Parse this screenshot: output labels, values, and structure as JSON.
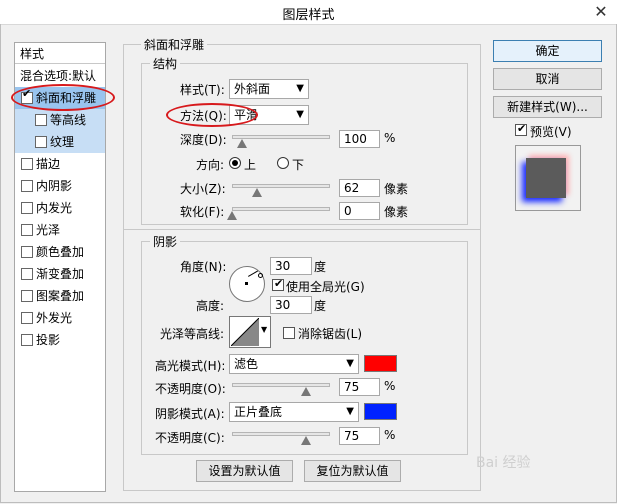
{
  "window": {
    "title": "图层样式",
    "close_icon": "close-icon"
  },
  "style_list": {
    "header": "样式",
    "items": [
      {
        "label": "混合选项:默认",
        "checkbox": false,
        "checked": false,
        "sub": false,
        "state": "none"
      },
      {
        "label": "斜面和浮雕",
        "checkbox": true,
        "checked": true,
        "sub": false,
        "state": "selected"
      },
      {
        "label": "等高线",
        "checkbox": true,
        "checked": false,
        "sub": true,
        "state": "sub"
      },
      {
        "label": "纹理",
        "checkbox": true,
        "checked": false,
        "sub": true,
        "state": "sub"
      },
      {
        "label": "描边",
        "checkbox": true,
        "checked": false,
        "sub": false,
        "state": "none"
      },
      {
        "label": "内阴影",
        "checkbox": true,
        "checked": false,
        "sub": false,
        "state": "none"
      },
      {
        "label": "内发光",
        "checkbox": true,
        "checked": false,
        "sub": false,
        "state": "none"
      },
      {
        "label": "光泽",
        "checkbox": true,
        "checked": false,
        "sub": false,
        "state": "none"
      },
      {
        "label": "颜色叠加",
        "checkbox": true,
        "checked": false,
        "sub": false,
        "state": "none"
      },
      {
        "label": "渐变叠加",
        "checkbox": true,
        "checked": false,
        "sub": false,
        "state": "none"
      },
      {
        "label": "图案叠加",
        "checkbox": true,
        "checked": false,
        "sub": false,
        "state": "none"
      },
      {
        "label": "外发光",
        "checkbox": true,
        "checked": false,
        "sub": false,
        "state": "none"
      },
      {
        "label": "投影",
        "checkbox": true,
        "checked": false,
        "sub": false,
        "state": "none"
      }
    ]
  },
  "bevel": {
    "group_title": "斜面和浮雕",
    "structure_title": "结构",
    "style_label": "样式(T):",
    "style_value": "外斜面",
    "technique_label": "方法(Q):",
    "technique_value": "平滑",
    "depth_label": "深度(D):",
    "depth_value": "100",
    "depth_unit": "%",
    "depth_level": 0.1,
    "direction_label": "方向:",
    "direction_up": "上",
    "direction_down": "下",
    "size_label": "大小(Z):",
    "size_value": "62",
    "size_unit": "像素",
    "size_level": 0.25,
    "soften_label": "软化(F):",
    "soften_value": "0",
    "soften_unit": "像素",
    "soften_level": 0.0
  },
  "shading": {
    "group_title": "阴影",
    "angle_label": "角度(N):",
    "angle_value": "30",
    "angle_unit": "度",
    "global_light_label": "使用全局光(G)",
    "altitude_label": "高度:",
    "altitude_value": "30",
    "altitude_unit": "度",
    "gloss_contour_label": "光泽等高线:",
    "anti_alias_label": "消除锯齿(L)",
    "highlight_mode_label": "高光模式(H):",
    "highlight_mode_value": "滤色",
    "highlight_color": "#ff0000",
    "highlight_opacity_label": "不透明度(O):",
    "highlight_opacity_value": "75",
    "highlight_opacity_unit": "%",
    "highlight_opacity_level": 0.75,
    "shadow_mode_label": "阴影模式(A):",
    "shadow_mode_value": "正片叠底",
    "shadow_color": "#0022ff",
    "shadow_opacity_label": "不透明度(C):",
    "shadow_opacity_value": "75",
    "shadow_opacity_unit": "%",
    "shadow_opacity_level": 0.75
  },
  "bottom_buttons": {
    "make_default": "设置为默认值",
    "reset_default": "复位为默认值"
  },
  "right_panel": {
    "ok": "确定",
    "cancel": "取消",
    "new_style": "新建样式(W)...",
    "preview_label": "预览(V)"
  },
  "watermark": "Bai 经验"
}
